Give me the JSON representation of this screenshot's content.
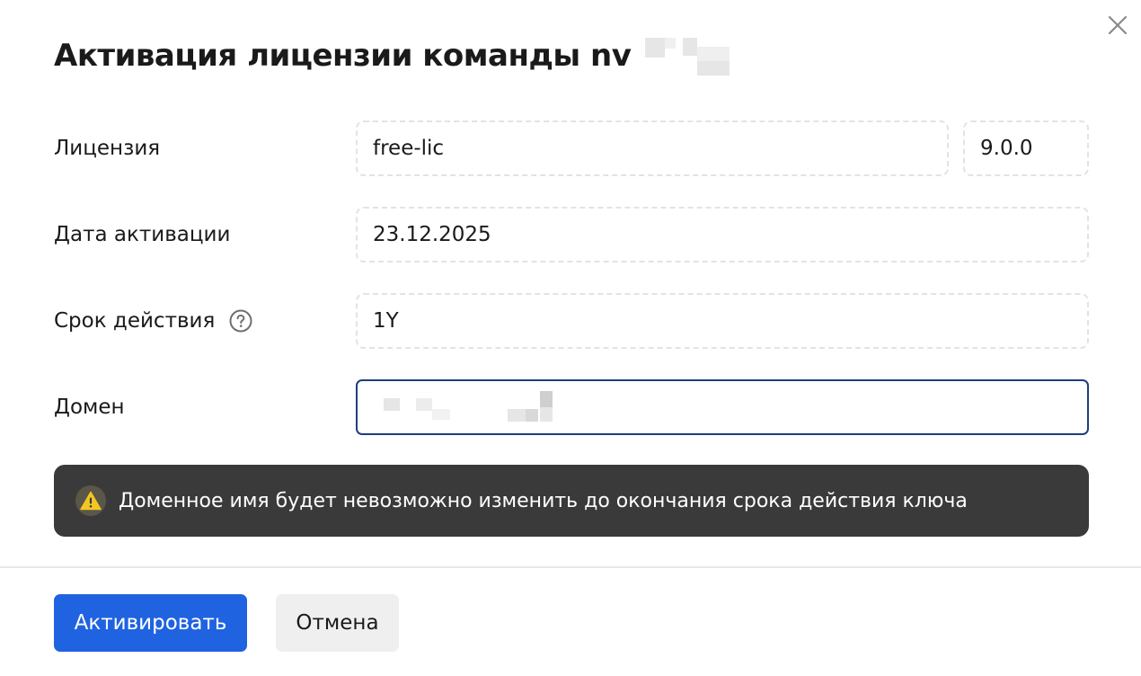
{
  "dialog": {
    "title": "Активация лицензии команды nv",
    "close_icon": "close-icon"
  },
  "fields": {
    "license": {
      "label": "Лицензия",
      "value": "free-lic",
      "version": "9.0.0"
    },
    "activation_date": {
      "label": "Дата активации",
      "value": "23.12.2025"
    },
    "validity": {
      "label": "Срок действия",
      "value": "1Y",
      "help_icon": "question-circle-icon"
    },
    "domain": {
      "label": "Домен"
    }
  },
  "warning": {
    "icon": "warning-triangle-icon",
    "text": "Доменное имя будет невозможно изменить до окончания срока действия ключа"
  },
  "footer": {
    "activate_label": "Активировать",
    "cancel_label": "Отмена"
  },
  "colors": {
    "primary": "#1f63e0",
    "warning_bg": "#3a3a3a",
    "warning_icon": "#f3c623",
    "active_border": "#1f3f7a"
  }
}
